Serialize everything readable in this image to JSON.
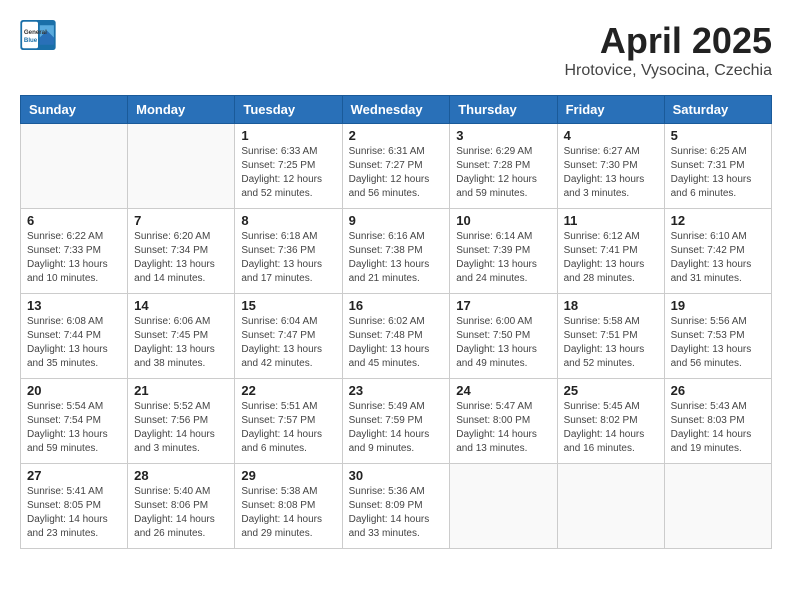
{
  "header": {
    "logo_general": "General",
    "logo_blue": "Blue",
    "month_title": "April 2025",
    "location": "Hrotovice, Vysocina, Czechia"
  },
  "weekdays": [
    "Sunday",
    "Monday",
    "Tuesday",
    "Wednesday",
    "Thursday",
    "Friday",
    "Saturday"
  ],
  "weeks": [
    [
      {
        "day": "",
        "info": ""
      },
      {
        "day": "",
        "info": ""
      },
      {
        "day": "1",
        "info": "Sunrise: 6:33 AM\nSunset: 7:25 PM\nDaylight: 12 hours and 52 minutes."
      },
      {
        "day": "2",
        "info": "Sunrise: 6:31 AM\nSunset: 7:27 PM\nDaylight: 12 hours and 56 minutes."
      },
      {
        "day": "3",
        "info": "Sunrise: 6:29 AM\nSunset: 7:28 PM\nDaylight: 12 hours and 59 minutes."
      },
      {
        "day": "4",
        "info": "Sunrise: 6:27 AM\nSunset: 7:30 PM\nDaylight: 13 hours and 3 minutes."
      },
      {
        "day": "5",
        "info": "Sunrise: 6:25 AM\nSunset: 7:31 PM\nDaylight: 13 hours and 6 minutes."
      }
    ],
    [
      {
        "day": "6",
        "info": "Sunrise: 6:22 AM\nSunset: 7:33 PM\nDaylight: 13 hours and 10 minutes."
      },
      {
        "day": "7",
        "info": "Sunrise: 6:20 AM\nSunset: 7:34 PM\nDaylight: 13 hours and 14 minutes."
      },
      {
        "day": "8",
        "info": "Sunrise: 6:18 AM\nSunset: 7:36 PM\nDaylight: 13 hours and 17 minutes."
      },
      {
        "day": "9",
        "info": "Sunrise: 6:16 AM\nSunset: 7:38 PM\nDaylight: 13 hours and 21 minutes."
      },
      {
        "day": "10",
        "info": "Sunrise: 6:14 AM\nSunset: 7:39 PM\nDaylight: 13 hours and 24 minutes."
      },
      {
        "day": "11",
        "info": "Sunrise: 6:12 AM\nSunset: 7:41 PM\nDaylight: 13 hours and 28 minutes."
      },
      {
        "day": "12",
        "info": "Sunrise: 6:10 AM\nSunset: 7:42 PM\nDaylight: 13 hours and 31 minutes."
      }
    ],
    [
      {
        "day": "13",
        "info": "Sunrise: 6:08 AM\nSunset: 7:44 PM\nDaylight: 13 hours and 35 minutes."
      },
      {
        "day": "14",
        "info": "Sunrise: 6:06 AM\nSunset: 7:45 PM\nDaylight: 13 hours and 38 minutes."
      },
      {
        "day": "15",
        "info": "Sunrise: 6:04 AM\nSunset: 7:47 PM\nDaylight: 13 hours and 42 minutes."
      },
      {
        "day": "16",
        "info": "Sunrise: 6:02 AM\nSunset: 7:48 PM\nDaylight: 13 hours and 45 minutes."
      },
      {
        "day": "17",
        "info": "Sunrise: 6:00 AM\nSunset: 7:50 PM\nDaylight: 13 hours and 49 minutes."
      },
      {
        "day": "18",
        "info": "Sunrise: 5:58 AM\nSunset: 7:51 PM\nDaylight: 13 hours and 52 minutes."
      },
      {
        "day": "19",
        "info": "Sunrise: 5:56 AM\nSunset: 7:53 PM\nDaylight: 13 hours and 56 minutes."
      }
    ],
    [
      {
        "day": "20",
        "info": "Sunrise: 5:54 AM\nSunset: 7:54 PM\nDaylight: 13 hours and 59 minutes."
      },
      {
        "day": "21",
        "info": "Sunrise: 5:52 AM\nSunset: 7:56 PM\nDaylight: 14 hours and 3 minutes."
      },
      {
        "day": "22",
        "info": "Sunrise: 5:51 AM\nSunset: 7:57 PM\nDaylight: 14 hours and 6 minutes."
      },
      {
        "day": "23",
        "info": "Sunrise: 5:49 AM\nSunset: 7:59 PM\nDaylight: 14 hours and 9 minutes."
      },
      {
        "day": "24",
        "info": "Sunrise: 5:47 AM\nSunset: 8:00 PM\nDaylight: 14 hours and 13 minutes."
      },
      {
        "day": "25",
        "info": "Sunrise: 5:45 AM\nSunset: 8:02 PM\nDaylight: 14 hours and 16 minutes."
      },
      {
        "day": "26",
        "info": "Sunrise: 5:43 AM\nSunset: 8:03 PM\nDaylight: 14 hours and 19 minutes."
      }
    ],
    [
      {
        "day": "27",
        "info": "Sunrise: 5:41 AM\nSunset: 8:05 PM\nDaylight: 14 hours and 23 minutes."
      },
      {
        "day": "28",
        "info": "Sunrise: 5:40 AM\nSunset: 8:06 PM\nDaylight: 14 hours and 26 minutes."
      },
      {
        "day": "29",
        "info": "Sunrise: 5:38 AM\nSunset: 8:08 PM\nDaylight: 14 hours and 29 minutes."
      },
      {
        "day": "30",
        "info": "Sunrise: 5:36 AM\nSunset: 8:09 PM\nDaylight: 14 hours and 33 minutes."
      },
      {
        "day": "",
        "info": ""
      },
      {
        "day": "",
        "info": ""
      },
      {
        "day": "",
        "info": ""
      }
    ]
  ]
}
